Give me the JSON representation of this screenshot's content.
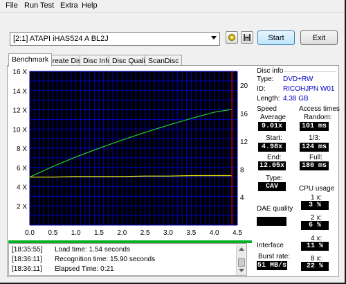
{
  "menu": [
    "File",
    "Run Test",
    "Extra",
    "Help"
  ],
  "toolbar": {
    "drive": "[2:1]   ATAPI iHAS524   A BL2J",
    "start_label": "Start",
    "exit_label": "Exit"
  },
  "tabs": [
    "Benchmark",
    "Create Disc",
    "Disc Info",
    "Disc Quality",
    "ScanDisc"
  ],
  "disc_info": {
    "heading": "Disc info",
    "type_label": "Type:",
    "type_value": "DVD+RW",
    "id_label": "ID:",
    "id_value": "RICOHJPN W01",
    "length_label": "Length:",
    "length_value": "4.38 GB"
  },
  "speed": {
    "heading": "Speed",
    "average_label": "Average",
    "average_value": "9.01x",
    "start_label": "Start:",
    "start_value": "4.98x",
    "end_label": "End:",
    "end_value": "12.05x",
    "type_label": "Type:",
    "type_value": "CAV"
  },
  "access_times": {
    "heading": "Access times",
    "random_label": "Random:",
    "random_value": "101 ms",
    "third_label": "1/3:",
    "third_value": "124 ms",
    "full_label": "Full:",
    "full_value": "180 ms"
  },
  "cpu": {
    "heading": "CPU usage",
    "x1_label": "1 x:",
    "x1_value": "3 %",
    "x2_label": "2 x:",
    "x2_value": "6 %",
    "x4_label": "4 x:",
    "x4_value": "11 %",
    "x8_label": "8 x:",
    "x8_value": "22 %"
  },
  "dae": {
    "heading": "DAE quality"
  },
  "interface": {
    "heading": "Interface",
    "burst_label": "Burst rate:",
    "burst_value": "51 MB/s"
  },
  "progress": {
    "fraction": 1.0,
    "color": "#06b025"
  },
  "log": [
    {
      "time": "[18:35:55]",
      "text": "Load time: 1.54 seconds"
    },
    {
      "time": "[18:36:11]",
      "text": "Recognition time: 15.90 seconds"
    },
    {
      "time": "[18:36:11]",
      "text": "Elapsed Time:  0:21"
    }
  ],
  "chart_data": {
    "type": "line",
    "xlabel": "",
    "ylabel": "",
    "xlim": [
      0,
      4.5
    ],
    "ylim": [
      0,
      16
    ],
    "y2lim": [
      0,
      22
    ],
    "x_ticks": [
      "0.0",
      "0.5",
      "1.0",
      "1.5",
      "2.0",
      "2.5",
      "3.0",
      "3.5",
      "4.0",
      "4.5"
    ],
    "y_ticks": [
      "2 X",
      "4 X",
      "6 X",
      "8 X",
      "10 X",
      "12 X",
      "14 X",
      "16 X"
    ],
    "y2_ticks": [
      "4",
      "8",
      "12",
      "16",
      "20"
    ],
    "grid": true,
    "background": "#000000",
    "grid_color": "#0000c0",
    "series": [
      {
        "color": "#22c02a",
        "x": [
          0.0,
          0.5,
          1.0,
          1.5,
          2.0,
          2.5,
          3.0,
          3.5,
          4.0,
          4.38
        ],
        "y": [
          5.0,
          6.1,
          7.1,
          8.0,
          8.85,
          9.65,
          10.4,
          11.1,
          11.75,
          12.05
        ]
      },
      {
        "color": "#e6e600",
        "x": [
          0.0,
          0.5,
          1.0,
          1.5,
          2.0,
          2.5,
          3.0,
          3.5,
          4.0,
          4.38
        ],
        "y": [
          5.0,
          5.0,
          5.05,
          5.05,
          5.05,
          5.1,
          5.1,
          5.15,
          5.15,
          5.15
        ]
      }
    ],
    "end_marker_x": 4.38,
    "end_marker_color": "#c00000"
  }
}
